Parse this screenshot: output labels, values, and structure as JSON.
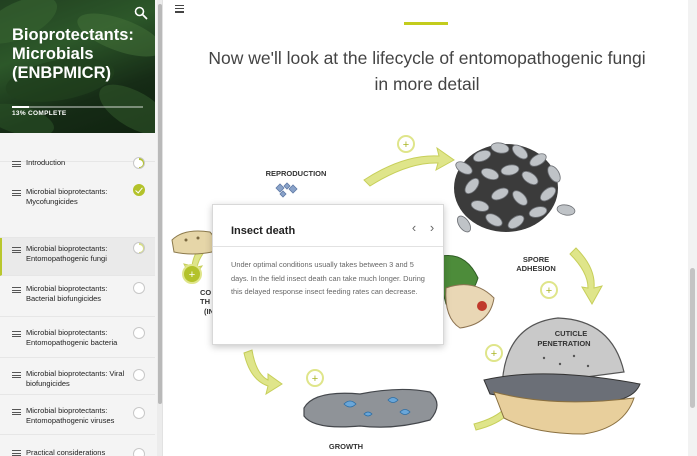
{
  "course": {
    "title": "Bioprotectants: Microbials (ENBPMICR)",
    "progress_label": "13% COMPLETE",
    "progress_fraction": 0.13
  },
  "icons": {
    "search": "search-icon",
    "menu": "hamburger-icon"
  },
  "colors": {
    "accent": "#c3cc1d",
    "done": "#b3c22a"
  },
  "menu": [
    {
      "label": "Introduction",
      "status": "partial"
    },
    {
      "label": "Microbial bioprotectants: Mycofungicides",
      "status": "done"
    },
    {
      "label": "Microbial bioprotectants: Entomopathogenic fungi",
      "status": "partial-light",
      "active": true
    },
    {
      "label": "Microbial bioprotectants: Bacterial biofungicides",
      "status": "empty"
    },
    {
      "label": "Microbial bioprotectants: Entomopathogenic bacteria",
      "status": "empty"
    },
    {
      "label": "Microbial bioprotectants: Viral biofungicides",
      "status": "empty"
    },
    {
      "label": "Microbial bioprotectants: Entomopathogenic viruses",
      "status": "empty"
    },
    {
      "label": "Practical considerations",
      "status": "empty"
    }
  ],
  "main": {
    "heading": "Now we'll look at the lifecycle of entomopathogenic fungi in more detail"
  },
  "diagram": {
    "stages": {
      "reproduction": "REPRODUCTION",
      "spore_adhesion_1": "SPORE",
      "spore_adhesion_2": "ADHESION",
      "cuticle_penetration_1": "CUTICLE",
      "cuticle_penetration_2": "PENETRATION",
      "growth": "GROWTH",
      "partial_1": "CO",
      "partial_2": "TH",
      "partial_3": "(IN"
    },
    "hotspot_symbol": "+"
  },
  "popup": {
    "title": "Insect death",
    "prev": "‹",
    "next": "›",
    "body": "Under optimal conditions usually takes between 3 and 5 days. In the field insect death can take much longer. During this delayed response insect feeding rates can decrease."
  }
}
